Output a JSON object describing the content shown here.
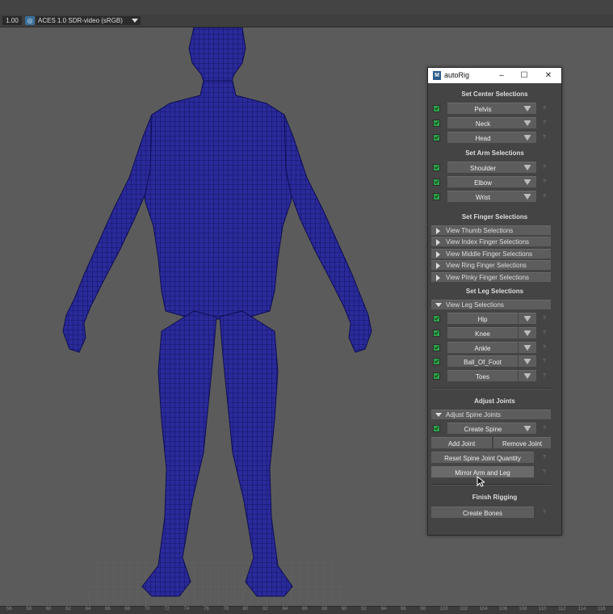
{
  "toolbar": {
    "exposure_value": "1.00",
    "color_management_icon": "color-management-icon",
    "view_transform": "ACES 1.0 SDR-video (sRGB)"
  },
  "viewport": {
    "model_color": "#1a1a8c"
  },
  "ruler": {
    "ticks": [
      "56",
      "58",
      "60",
      "62",
      "64",
      "66",
      "68",
      "70",
      "72",
      "74",
      "76",
      "78",
      "80",
      "82",
      "84",
      "86",
      "88",
      "90",
      "92",
      "94",
      "96",
      "98",
      "100",
      "102",
      "104",
      "106",
      "108",
      "110",
      "112",
      "114",
      "116"
    ]
  },
  "window": {
    "title": "autoRig",
    "minimize": "–",
    "maximize": "☐",
    "close": "✕"
  },
  "center": {
    "title": "Set Center Selections",
    "items": [
      "Pelvis",
      "Neck",
      "Head"
    ]
  },
  "arm": {
    "title": "Set Arm Selections",
    "items": [
      "Shoulder",
      "Elbow",
      "Wrist"
    ]
  },
  "finger": {
    "title": "Set Finger Selections",
    "items": [
      "View Thumb Selections",
      "View Index Finger Selections",
      "View Middle Finger Selections",
      "View Ring Finger Selections",
      "View Pinky Finger Selections"
    ]
  },
  "leg": {
    "title": "Set Leg Selections",
    "frame": "View Leg Selections",
    "items": [
      "Hip",
      "Knee",
      "Ankle",
      "Ball_Of_Foot",
      "Toes"
    ]
  },
  "adjust": {
    "title": "Adjust Joints",
    "frame": "Adjust Spine Joints",
    "create_spine": "Create Spine",
    "add_joint": "Add Joint",
    "remove_joint": "Remove Joint",
    "reset_quantity": "Reset Spine Joint Quantity",
    "mirror": "Mirror Arm and Leg"
  },
  "finish": {
    "title": "Finish Rigging",
    "create_bones": "Create Bones"
  },
  "help_mark": "?"
}
